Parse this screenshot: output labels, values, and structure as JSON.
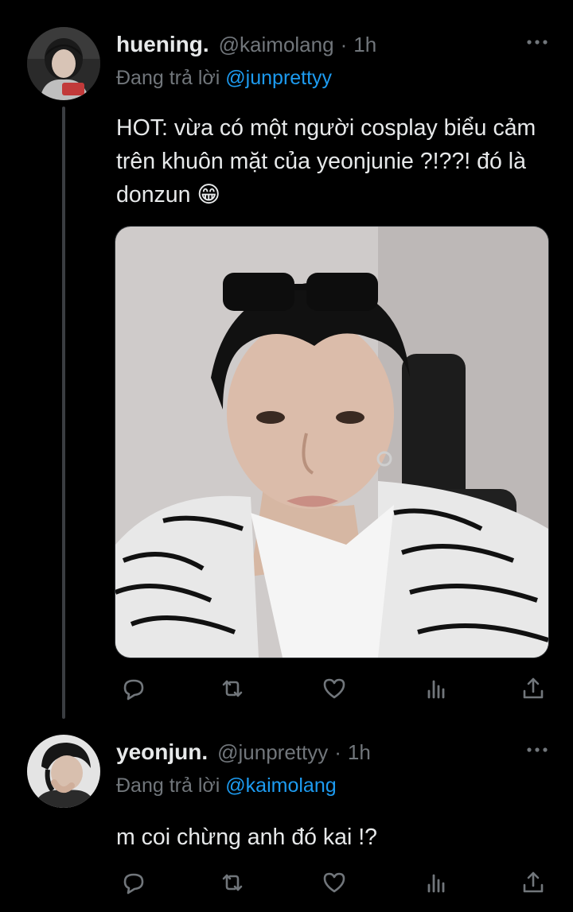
{
  "tweets": [
    {
      "name": "huening.",
      "handle": "@kaimolang",
      "time": "1h",
      "replying_prefix": "Đang trả lời",
      "replying_to": "@junprettyy",
      "text": "HOT: vừa có một người cosplay biểu cảm trên khuôn mặt của yeonjunie ?!??! đó là donzun 😁",
      "avatar_icon": "user-avatar-photo",
      "media_icon": "photo-portrait"
    },
    {
      "name": "yeonjun.",
      "handle": "@junprettyy",
      "time": "1h",
      "replying_prefix": "Đang trả lời",
      "replying_to": "@kaimolang",
      "text": "m coi chừng anh đó kai !?",
      "avatar_icon": "user-avatar-photo"
    }
  ],
  "separator": "·",
  "colors": {
    "background": "#000000",
    "text": "#e7e9ea",
    "muted": "#71767b",
    "link": "#1d9bf0",
    "thread_line": "#3a3d41"
  }
}
